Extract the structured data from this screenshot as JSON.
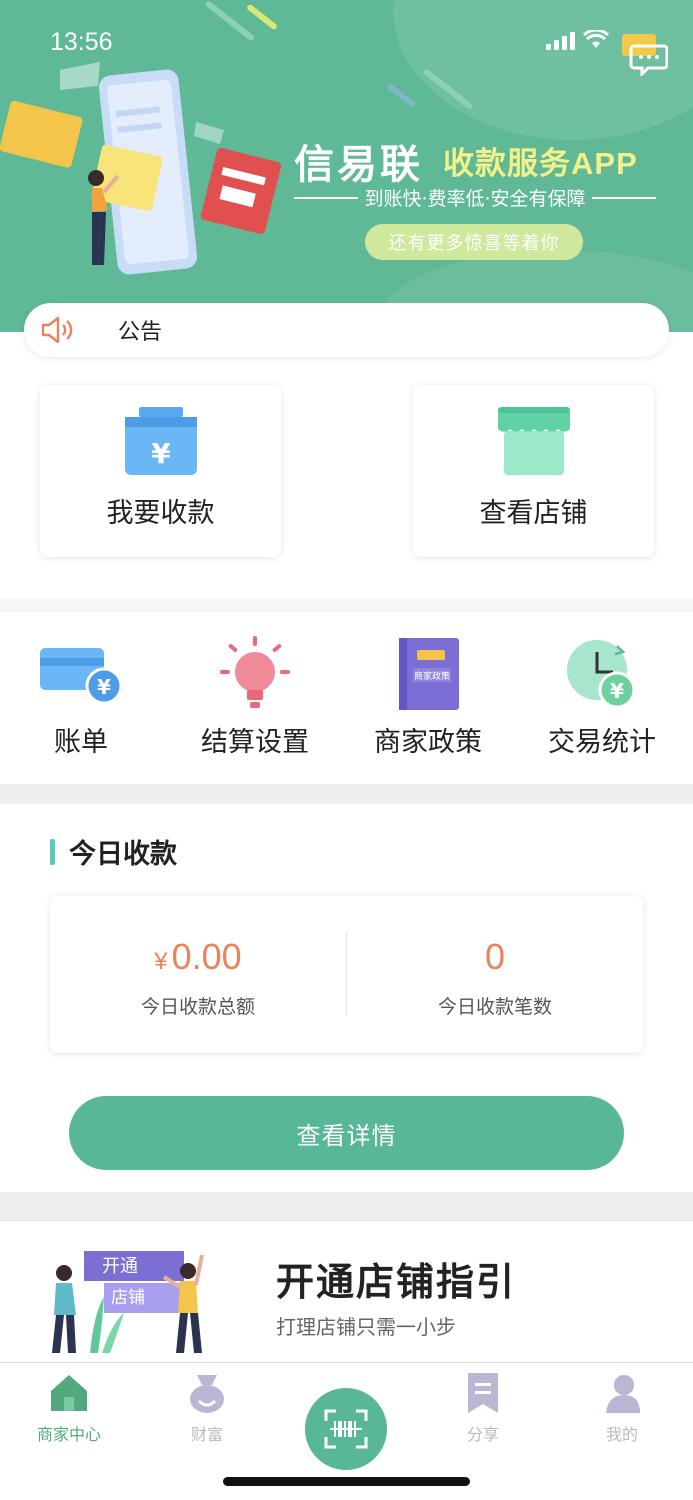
{
  "status_bar": {
    "time": "13:56"
  },
  "banner": {
    "title": "信易联",
    "title_highlight": "收款服务APP",
    "tagline": "到账快·费率低·安全有保障",
    "pill_text": "还有更多惊喜等着你"
  },
  "notice": {
    "label": "公告"
  },
  "quick_actions": [
    {
      "label": "我要收款",
      "icon": "wallet-yen-icon"
    },
    {
      "label": "查看店铺",
      "icon": "storefront-icon"
    }
  ],
  "menu": [
    {
      "label": "账单",
      "icon": "card-yen-icon"
    },
    {
      "label": "结算设置",
      "icon": "lightbulb-icon"
    },
    {
      "label": "商家政策",
      "icon": "policy-book-icon",
      "book_text": "商家政策"
    },
    {
      "label": "交易统计",
      "icon": "clock-yen-icon"
    }
  ],
  "today": {
    "heading": "今日收款",
    "amount_currency": "¥",
    "amount_value": "0.00",
    "amount_label": "今日收款总额",
    "count_value": "0",
    "count_label": "今日收款笔数",
    "detail_button": "查看详情"
  },
  "guide": {
    "title": "开通店铺指引",
    "subtitle": "打理店铺只需一小步",
    "sign_top": "开通",
    "sign_bottom": "店铺"
  },
  "tabbar": {
    "items": [
      {
        "label": "商家中心",
        "icon": "home-icon",
        "active": true
      },
      {
        "label": "财富",
        "icon": "money-bag-icon",
        "active": false
      },
      {
        "label": "分享",
        "icon": "bookmark-icon",
        "active": false
      },
      {
        "label": "我的",
        "icon": "user-icon",
        "active": false
      }
    ],
    "scan_icon": "scan-barcode-icon"
  },
  "colors": {
    "brand_green": "#5fb996",
    "button_green": "#57b796",
    "amount_orange": "#e8835c",
    "accent_teal": "#5cc9c1",
    "banner_yellow": "#f4f08a"
  }
}
